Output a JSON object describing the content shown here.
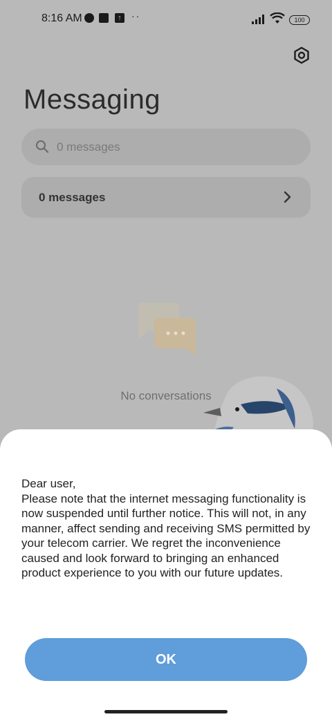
{
  "status_bar": {
    "time": "8:16 AM",
    "dots": "··",
    "battery": "100",
    "icons": [
      "data-saver-icon",
      "square-notification-icon",
      "upload-icon",
      "signal-icon",
      "wifi-icon",
      "battery-icon"
    ]
  },
  "header": {
    "title": "Messaging",
    "settings_icon": "gear-icon"
  },
  "search": {
    "placeholder": "0 messages",
    "icon": "search-icon"
  },
  "messages_row": {
    "label": "0 messages"
  },
  "empty_state": {
    "text": "No conversations",
    "icon": "chat-bubbles-icon"
  },
  "dialog": {
    "text": "Dear user,\nPlease note that the internet messaging functionality is now suspended until further notice. This will not, in any manner, affect sending and receiving SMS permitted by your telecom carrier. We regret the inconvenience caused and look forward to bringing an enhanced product experience to you with our future updates.",
    "ok_label": "OK"
  },
  "colors": {
    "overlay": "#b9b9b9",
    "accent": "#5f9ddb",
    "dialog_bg": "#ffffff"
  }
}
